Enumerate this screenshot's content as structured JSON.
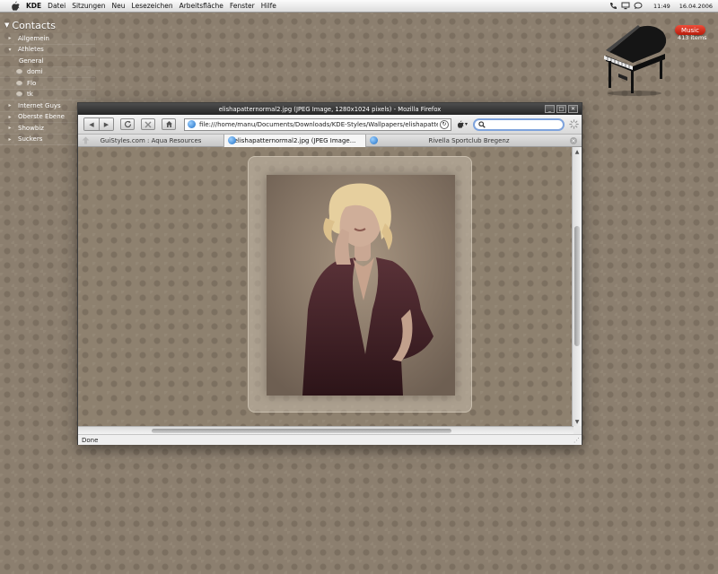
{
  "menubar": {
    "app": "KDE",
    "items": [
      "Datei",
      "Sitzungen",
      "Neu",
      "Lesezeichen",
      "Arbeitsfläche",
      "Fenster",
      "Hilfe"
    ],
    "clock": "11:49",
    "date": "16.04.2006"
  },
  "contacts": {
    "title": "Contacts",
    "groups": [
      {
        "label": "Allgemein"
      },
      {
        "label": "Athletes"
      },
      {
        "label": "General"
      },
      {
        "label": "domi"
      },
      {
        "label": "Flo"
      },
      {
        "label": "tk"
      },
      {
        "label": "Internet Guys"
      },
      {
        "label": "Oberste Ebene"
      },
      {
        "label": "Showbiz"
      },
      {
        "label": "Suckers"
      }
    ]
  },
  "music_widget": {
    "badge": "Music",
    "count": "413 items"
  },
  "browser": {
    "title": "elishapatternormal2.jpg (JPEG Image, 1280x1024 pixels) - Mozilla Firefox",
    "url": "file:///home/manu/Documents/Downloads/KDE-Styles/Wallpapers/elishapatternc",
    "search_placeholder": "",
    "tabs": [
      {
        "label": "GuiStyles.com : Aqua Resources"
      },
      {
        "label": "elishapatternormal2.jpg (JPEG Image..."
      },
      {
        "label": "Rivella Sportclub Bregenz"
      }
    ],
    "status": "Done"
  }
}
